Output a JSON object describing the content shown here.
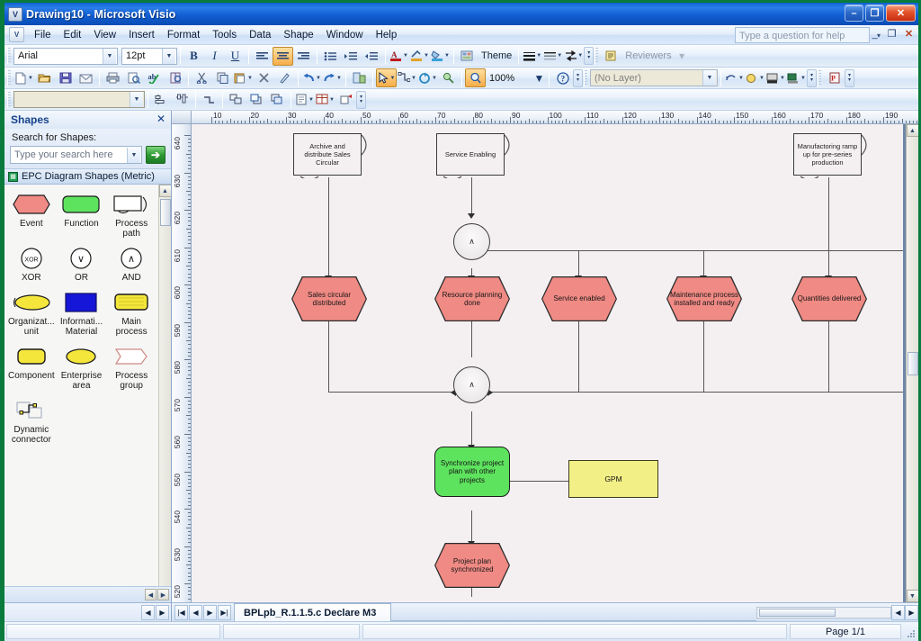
{
  "window": {
    "title": "Drawing10 - Microsoft Visio",
    "app_icon": "visio-icon",
    "minimize": "–",
    "maximize": "❐",
    "close": "✕"
  },
  "menubar": {
    "items": [
      "File",
      "Edit",
      "View",
      "Insert",
      "Format",
      "Tools",
      "Data",
      "Shape",
      "Window",
      "Help"
    ],
    "help_placeholder": "Type a question for help"
  },
  "format_toolbar": {
    "font_family": "Arial",
    "font_size": "12pt",
    "bold": "B",
    "italic": "I",
    "underline": "U",
    "align_left": "align-left-icon",
    "align_center": "align-center-icon",
    "align_right": "align-right-icon",
    "bullets": "bullet-list-icon",
    "increase_indent": "increase-indent-icon",
    "decrease_indent": "decrease-indent-icon",
    "font_color": "A",
    "line_color": "line-color-icon",
    "fill_color": "fill-color-icon",
    "theme_label": "Theme",
    "line_weight": "line-weight-icon",
    "line_pattern": "line-pattern-icon",
    "line_ends": "line-ends-icon",
    "reviewers_label": "Reviewers"
  },
  "standard_toolbar": {
    "new": "new-icon",
    "open": "open-icon",
    "save": "save-icon",
    "email": "email-icon",
    "print": "print-icon",
    "print_preview": "print-preview-icon",
    "spelling": "spelling-icon",
    "research": "research-icon",
    "cut": "cut-icon",
    "copy": "copy-icon",
    "paste": "paste-icon",
    "delete": "delete-icon",
    "format_painter": "format-painter-icon",
    "undo": "undo-icon",
    "redo": "redo-icon",
    "shapes_window": "shapes-window-icon",
    "pointer_tool": "pointer-tool-icon",
    "connector_tool": "connector-tool-icon",
    "rotate_tool": "rotate-tool-icon",
    "connect_shapes": "connect-shapes-icon",
    "zoom_tool": "zoom-tool-icon",
    "zoom_value": "100%",
    "help": "help-icon"
  },
  "action_toolbar": {
    "layer_select_value": "(No Layer)",
    "style_value": "",
    "align_left": "align-objects-left-icon",
    "align_top": "align-objects-top-icon",
    "distribute": "distribute-icon",
    "group": "group-icon",
    "bring_front": "bring-to-front-icon",
    "send_back": "send-to-back-icon",
    "rotate_left": "rotate-left-icon",
    "rotate_right": "rotate-right-icon",
    "flip": "flip-icon",
    "layer_props": "layer-properties-icon",
    "assign_layer": "assign-layer-icon",
    "pdf_export": "pdf-icon"
  },
  "shapes_panel": {
    "title": "Shapes",
    "close": "✕",
    "search_label": "Search for Shapes:",
    "search_placeholder": "Type your search here",
    "search_value": "",
    "go_button": "➔",
    "stencil_name": "EPC Diagram Shapes (Metric)",
    "stencil_items": [
      {
        "label": "Event",
        "icon": "event-hexagon-icon",
        "color": "#f08a84"
      },
      {
        "label": "Function",
        "icon": "function-rounded-icon",
        "color": "#5ee35e"
      },
      {
        "label": "Process path",
        "icon": "process-path-icon",
        "color": "#ffffff"
      },
      {
        "label": "XOR",
        "icon": "xor-circle-icon",
        "color": "#ffffff"
      },
      {
        "label": "OR",
        "icon": "or-circle-icon",
        "color": "#ffffff"
      },
      {
        "label": "AND",
        "icon": "and-circle-icon",
        "color": "#ffffff"
      },
      {
        "label": "Organizat... unit",
        "icon": "organizational-unit-icon",
        "color": "#f4e63a"
      },
      {
        "label": "Informati... Material",
        "icon": "information-material-icon",
        "color": "#1616d8"
      },
      {
        "label": "Main process",
        "icon": "main-process-icon",
        "color": "#f4e63a"
      },
      {
        "label": "Component",
        "icon": "component-icon",
        "color": "#f4e63a"
      },
      {
        "label": "Enterprise area",
        "icon": "enterprise-area-icon",
        "color": "#f4e63a"
      },
      {
        "label": "Process group",
        "icon": "process-group-icon",
        "color": "#ffffff"
      },
      {
        "label": "Dynamic connector",
        "icon": "dynamic-connector-icon",
        "color": "#ffffff"
      }
    ]
  },
  "rulers": {
    "horizontal_ticks": [
      "10",
      "20",
      "30",
      "40",
      "50",
      "60",
      "70",
      "80",
      "90",
      "100",
      "110",
      "120",
      "130",
      "140",
      "150",
      "160",
      "170",
      "180",
      "190",
      "20"
    ],
    "vertical_ticks": [
      "640",
      "630",
      "620",
      "610",
      "600",
      "590",
      "580",
      "570",
      "560",
      "550",
      "540",
      "530",
      "520"
    ]
  },
  "diagram": {
    "nodes": [
      {
        "id": "n1",
        "type": "process-path",
        "text": "Archive and distribute Sales Circular"
      },
      {
        "id": "n2",
        "type": "process-path",
        "text": "Service Enabling"
      },
      {
        "id": "n3",
        "type": "process-path",
        "text": "Manufactoring ramp up for pre-series production"
      },
      {
        "id": "g1",
        "type": "and-gate",
        "text": "∧"
      },
      {
        "id": "g2",
        "type": "and-gate",
        "text": "∧"
      },
      {
        "id": "e1",
        "type": "event",
        "text": "Sales circular distributed"
      },
      {
        "id": "e2",
        "type": "event",
        "text": "Resource planning done"
      },
      {
        "id": "e3",
        "type": "event",
        "text": "Service enabled"
      },
      {
        "id": "e4",
        "type": "event",
        "text": "Maintenance process installed and ready"
      },
      {
        "id": "e5",
        "type": "event",
        "text": "Quantities delivered"
      },
      {
        "id": "f1",
        "type": "function",
        "text": "Synchronize project plan with other projects"
      },
      {
        "id": "i1",
        "type": "information",
        "text": "GPM"
      },
      {
        "id": "e6",
        "type": "event",
        "text": "Project plan synchronized"
      }
    ],
    "colors": {
      "event_fill": "#f08a84",
      "function_fill": "#5ee35e",
      "information_fill": "#f2ef86",
      "gate_fill": "#efecee",
      "connector": "#555555",
      "page_bg": "#f4f0f2"
    }
  },
  "page_tabs": {
    "first": "|◀",
    "prev": "◀",
    "next": "▶",
    "last": "▶|",
    "active_tab": "BPLpb_R.1.1.5.c Declare M3"
  },
  "statusbar": {
    "left": "",
    "middle": "",
    "right": "",
    "page_indicator": "Page 1/1"
  }
}
